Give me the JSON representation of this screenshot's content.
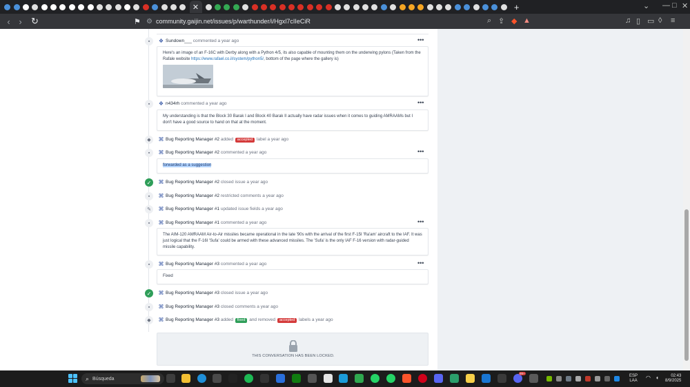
{
  "browser": {
    "url": "community.gaijin.net/issues/p/warthunder/i/Hgxl7cIIeCiR",
    "new_tab_label": "+",
    "active_tab_close": "✕",
    "tab_favicon_colors": [
      "#4a90d9",
      "#4a90d9",
      "#ffffff",
      "#e0e0e0",
      "#ffffff",
      "#ffffff",
      "#ffffff",
      "#ffffff",
      "#ffffff",
      "#ffffff",
      "#e0e0e0",
      "#e0e0e0",
      "#e0e0e0",
      "#ffffff",
      "#e0e0e0",
      "#d93025",
      "#4a90d9",
      "#e0e0e0",
      "#e0e0e0",
      "#e0e0e0",
      "#e0e0e0",
      "#34a853",
      "#34a853",
      "#34a853",
      "#e0e0e0",
      "#d93025",
      "#d93025",
      "#d93025",
      "#d93025",
      "#d93025",
      "#d93025",
      "#d93025",
      "#d93025",
      "#d93025",
      "#e0e0e0",
      "#e0e0e0",
      "#e0e0e0",
      "#e0e0e0",
      "#e0e0e0",
      "#4a90d9",
      "#e0e0e0",
      "#f5a623",
      "#f5a623",
      "#f5a623",
      "#e0e0e0",
      "#e0e0e0",
      "#e0e0e0",
      "#4a90d9",
      "#4a90d9",
      "#e0e0e0",
      "#4a90d9",
      "#4a90d9",
      "#e0e0e0"
    ]
  },
  "timeline": [
    {
      "kind": "comment-header",
      "user": "Sundown___",
      "action": "commented a year ago"
    },
    {
      "kind": "comment-body",
      "text": "Here's an image of an F-16C with Derby along with a Python 4/5, its also capable of mounting them on the underwing pylons (Taken from the Rafale website ",
      "link": "https://www.rafael.co.il/system/python5/",
      "text_after": ", bottom of the page where the gallery is)"
    },
    {
      "kind": "comment-header",
      "user": "n434rh",
      "action": "commented a year ago"
    },
    {
      "kind": "comment-body",
      "text": "My understanding is that the Block 30 Barak I and Block 40 Barak II actually have radar issues when it comes to guiding AMRAAMs but I don't have a good source to hand on that at the moment."
    },
    {
      "kind": "event",
      "user": "Bug Reporting Manager #2",
      "pre": "added",
      "badge": "accepted",
      "post": "label a year ago"
    },
    {
      "kind": "comment-header",
      "user": "Bug Reporting Manager #2",
      "action": "commented a year ago"
    },
    {
      "kind": "comment-body",
      "text": "forwarded as a suggestion"
    },
    {
      "kind": "event",
      "user": "Bug Reporting Manager #2",
      "text": "closed issue a year ago"
    },
    {
      "kind": "event",
      "user": "Bug Reporting Manager #2",
      "text": "restricted comments a year ago"
    },
    {
      "kind": "event",
      "user": "Bug Reporting Manager #1",
      "text": "updated issue fields a year ago"
    },
    {
      "kind": "comment-header",
      "user": "Bug Reporting Manager #1",
      "action": "commented a year ago"
    },
    {
      "kind": "comment-body",
      "text": "The AIM-120 AMRAAM Air-to-Air missiles became operational in the late '90s with the arrival of the first F-15I 'Ra'am' aircraft to the IAF. It was just logical that the F-16I 'Sufa' could be armed with these advanced missiles. The 'Sufa' is the only IAF F-16 version with radar-guided missile capability."
    },
    {
      "kind": "comment-header",
      "user": "Bug Reporting Manager #3",
      "action": "commented a year ago"
    },
    {
      "kind": "comment-body",
      "text": "Fixed"
    },
    {
      "kind": "event",
      "user": "Bug Reporting Manager #3",
      "text": "closed issue a year ago"
    },
    {
      "kind": "event",
      "user": "Bug Reporting Manager #3",
      "text": "closed comments a year ago"
    },
    {
      "kind": "event",
      "user": "Bug Reporting Manager #3",
      "pre": "added",
      "badge": "fixed",
      "mid": "and removed",
      "badge2": "accepted",
      "post": "labels a year ago"
    }
  ],
  "menu_dots": "•••",
  "locked_message": "THIS CONVERSATION HAS BEEN LOCKED.",
  "taskbar": {
    "search_placeholder": "Búsqueda",
    "language": "ESP",
    "layout": "LAA",
    "time": "02:43",
    "date": "8/9/2025",
    "notification_count": "99+"
  },
  "colors": {
    "accent_red": "#d43a3a",
    "accent_green": "#2f9e59",
    "link": "#1d6fb8"
  }
}
